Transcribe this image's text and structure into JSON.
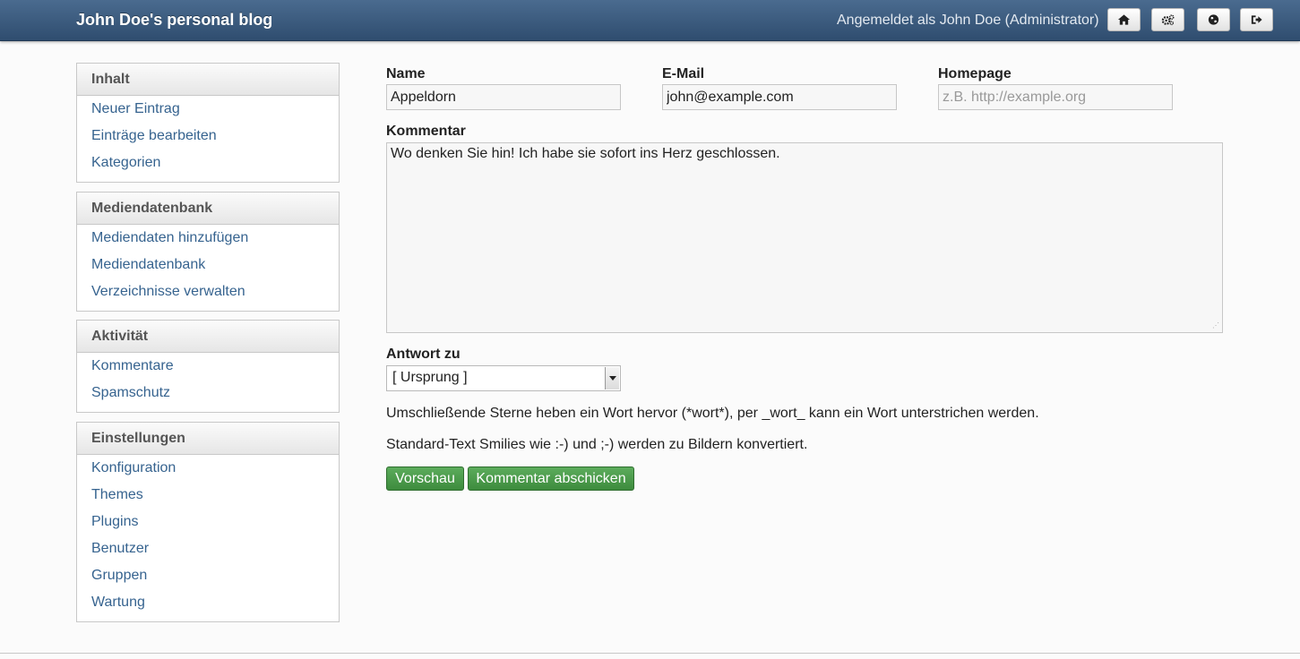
{
  "header": {
    "title": "John Doe's personal blog",
    "user_status": "Angemeldet als John Doe (Administrator)",
    "buttons": [
      {
        "icon": "home-icon"
      },
      {
        "icon": "gears-icon"
      },
      {
        "icon": "globe-icon"
      },
      {
        "icon": "logout-icon"
      }
    ]
  },
  "sidebar": {
    "panels": [
      {
        "title": "Inhalt",
        "items": [
          "Neuer Eintrag",
          "Einträge bearbeiten",
          "Kategorien"
        ]
      },
      {
        "title": "Mediendatenbank",
        "items": [
          "Mediendaten hinzufügen",
          "Mediendatenbank",
          "Verzeichnisse verwalten"
        ]
      },
      {
        "title": "Aktivität",
        "items": [
          "Kommentare",
          "Spamschutz"
        ]
      },
      {
        "title": "Einstellungen",
        "items": [
          "Konfiguration",
          "Themes",
          "Plugins",
          "Benutzer",
          "Gruppen",
          "Wartung"
        ]
      }
    ]
  },
  "form": {
    "name_label": "Name",
    "name_value": "Appeldorn",
    "email_label": "E-Mail",
    "email_value": "john@example.com",
    "homepage_label": "Homepage",
    "homepage_placeholder": "z.B. http://example.org",
    "comment_label": "Kommentar",
    "comment_value": "Wo denken Sie hin! Ich habe sie sofort ins Herz geschlossen.",
    "reply_label": "Antwort zu",
    "reply_selected": "[ Ursprung ]",
    "hint_markup": "Umschließende Sterne heben ein Wort hervor (*wort*), per _wort_ kann ein Wort unterstrichen werden.",
    "hint_smilies": "Standard-Text Smilies wie :-) und ;-) werden zu Bildern konvertiert.",
    "preview_button": "Vorschau",
    "submit_button": "Kommentar abschicken"
  }
}
